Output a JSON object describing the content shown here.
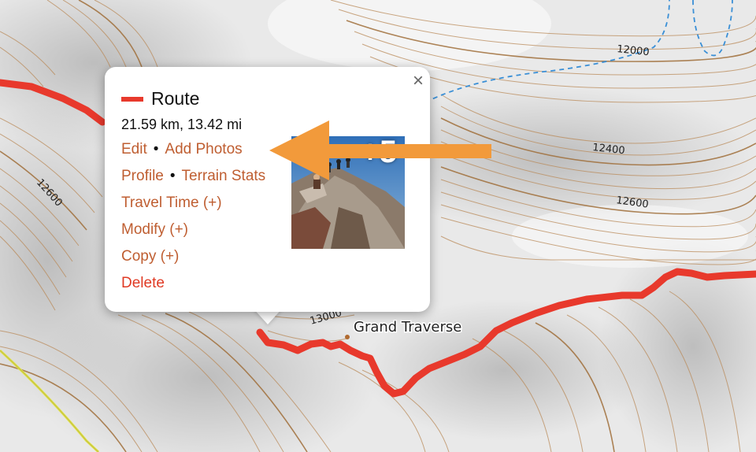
{
  "map": {
    "contour_labels": {
      "c12000": "12000",
      "c12400": "12400",
      "c12600_left": "12600",
      "c12600_right": "12600",
      "c13000": "13000"
    },
    "place_label": "Grand Traverse",
    "colors": {
      "route": "#e8392c",
      "contour": "#b98a58",
      "stream": "#3a8fd6",
      "trail": "#e3e24a"
    }
  },
  "popup": {
    "close_symbol": "×",
    "title": "Route",
    "distance": "21.59 km, 13.42 mi",
    "links": {
      "edit": "Edit",
      "add_photos": "Add Photos",
      "profile": "Profile",
      "terrain_stats": "Terrain Stats",
      "travel_time": "Travel Time (+)",
      "modify": "Modify (+)",
      "copy": "Copy (+)",
      "delete": "Delete"
    },
    "separator": "•",
    "photo_count": "+5",
    "colors": {
      "link": "#bf5e31",
      "delete": "#e03a24"
    }
  },
  "annotation": {
    "arrow_color": "#f29a3b",
    "icon": "arrow-left-icon"
  }
}
